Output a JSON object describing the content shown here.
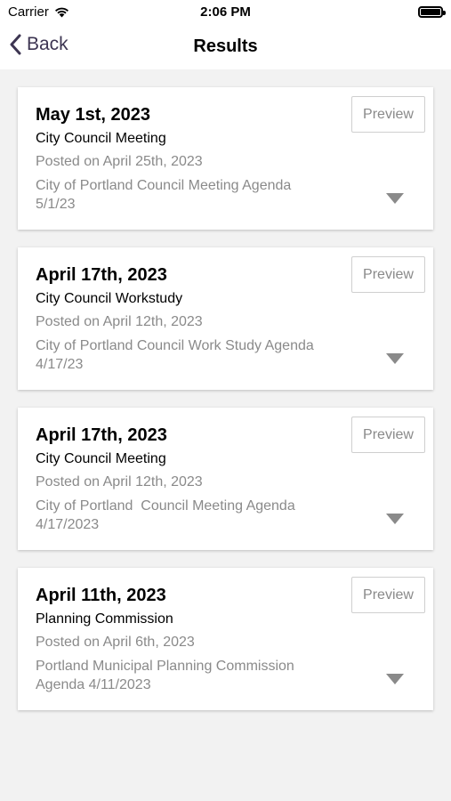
{
  "status_bar": {
    "carrier": "Carrier",
    "time": "2:06 PM"
  },
  "nav": {
    "back_label": "Back",
    "title": "Results"
  },
  "results": [
    {
      "date": "May 1st, 2023",
      "type": "City Council Meeting",
      "posted": "Posted on April 25th, 2023",
      "description": "City of Portland Council Meeting Agenda 5/1/23",
      "preview_label": "Preview"
    },
    {
      "date": "April 17th, 2023",
      "type": "City Council Workstudy",
      "posted": "Posted on April 12th, 2023",
      "description": "City of Portland Council Work Study Agenda 4/17/23",
      "preview_label": "Preview"
    },
    {
      "date": "April 17th, 2023",
      "type": "City Council Meeting",
      "posted": "Posted on April 12th, 2023",
      "description": "City of Portland  Council Meeting Agenda 4/17/2023",
      "preview_label": "Preview"
    },
    {
      "date": "April 11th, 2023",
      "type": "Planning Commission",
      "posted": "Posted on April 6th, 2023",
      "description": "Portland Municipal Planning Commission Agenda 4/11/2023",
      "preview_label": "Preview"
    }
  ],
  "colors": {
    "accent": "#3d3552",
    "muted_text": "#8a8a8a",
    "background": "#f2f2f2"
  },
  "icons": {
    "back": "chevron-left-icon",
    "expand": "caret-down-icon",
    "wifi": "wifi-icon",
    "battery": "battery-icon"
  }
}
